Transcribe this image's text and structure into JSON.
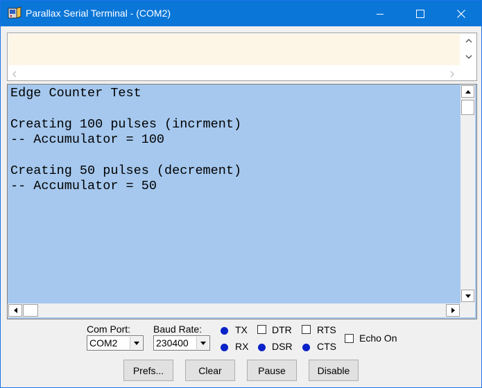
{
  "window": {
    "title": "Parallax Serial Terminal - (COM2)",
    "title_bar_color": "#0a76d8"
  },
  "transmit": {
    "text": "",
    "background": "#fdf6e7"
  },
  "receive": {
    "background": "#a6c8ee",
    "lines": [
      "Edge Counter Test",
      "",
      "Creating 100 pulses (incrment)",
      "-- Accumulator = 100",
      "",
      "Creating 50 pulses (decrement)",
      "-- Accumulator = 50"
    ]
  },
  "controls": {
    "com_port_label": "Com Port:",
    "com_port_value": "COM2",
    "baud_label": "Baud Rate:",
    "baud_value": "230400",
    "tx_label": "TX",
    "rx_label": "RX",
    "dtr_label": "DTR",
    "dsr_label": "DSR",
    "rts_label": "RTS",
    "cts_label": "CTS",
    "echo_label": "Echo On",
    "led_color": "#0a22c8"
  },
  "buttons": {
    "prefs": "Prefs...",
    "clear": "Clear",
    "pause": "Pause",
    "disable": "Disable"
  }
}
